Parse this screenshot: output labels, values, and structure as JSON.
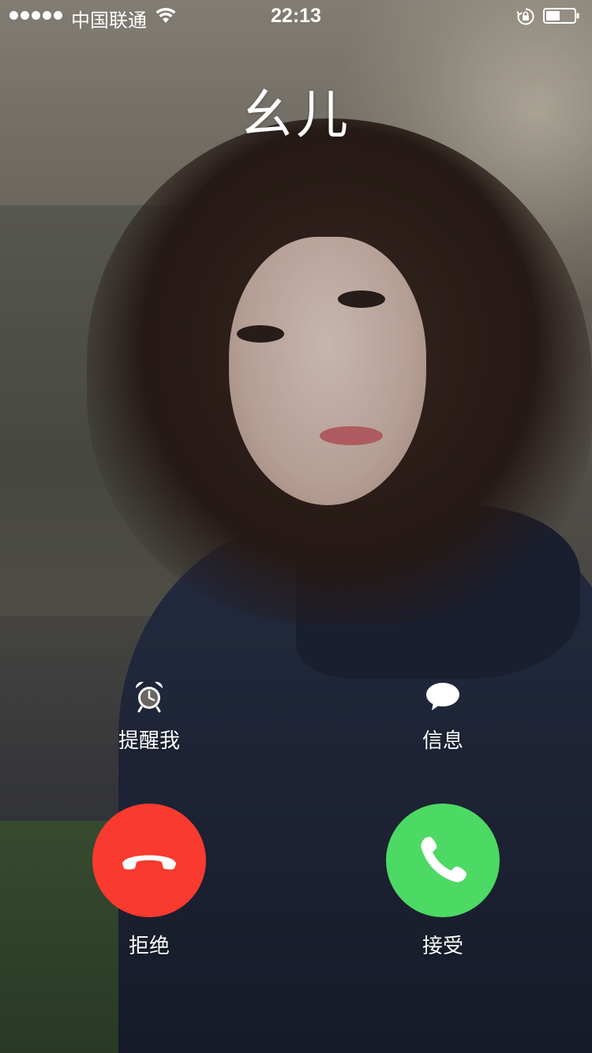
{
  "status_bar": {
    "carrier": "中国联通",
    "time": "22:13"
  },
  "caller": {
    "name": "幺儿"
  },
  "options": {
    "remind_label": "提醒我",
    "message_label": "信息"
  },
  "actions": {
    "decline_label": "拒绝",
    "accept_label": "接受"
  },
  "colors": {
    "decline": "#f93a2f",
    "accept": "#4cd964"
  },
  "icons": {
    "remind": "alarm-clock-icon",
    "message": "message-bubble-icon",
    "decline": "phone-hangup-icon",
    "accept": "phone-icon"
  }
}
